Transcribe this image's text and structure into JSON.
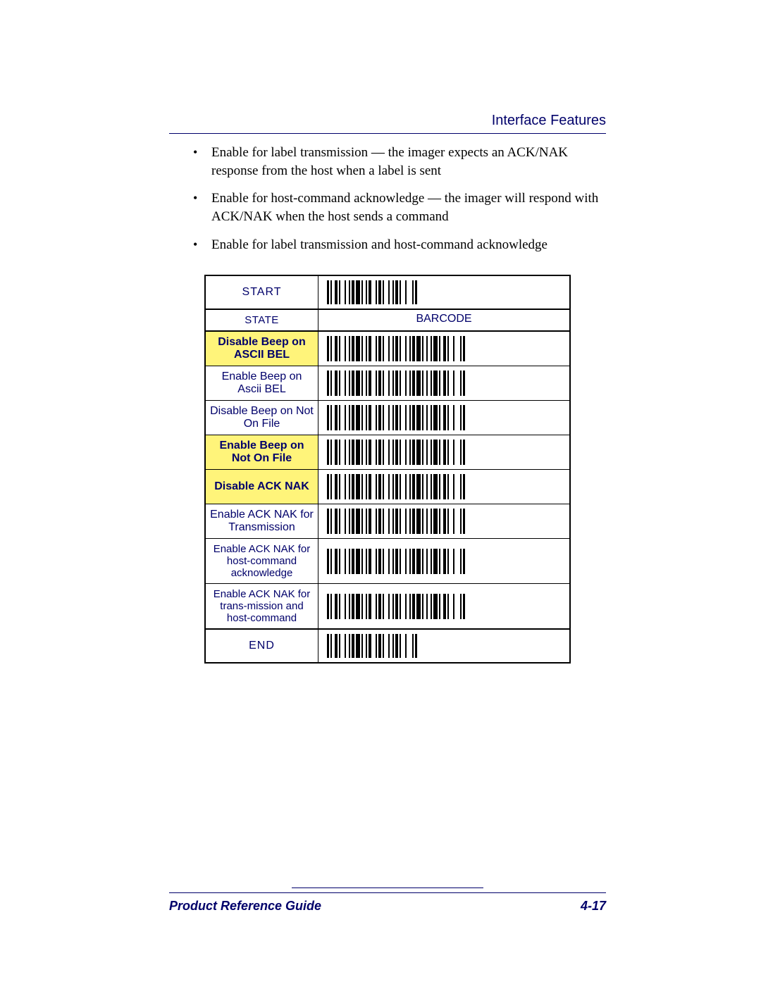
{
  "header": {
    "title": "Interface Features"
  },
  "bullets": [
    "Enable for label transmission — the imager expects an ACK/NAK response from the host when a label is sent",
    "Enable for host-command acknowledge — the imager will respond with ACK/NAK when the host sends a command",
    "Enable for label transmission and host-command acknowledge"
  ],
  "table": {
    "start_label": "START",
    "end_label": "END",
    "header_state": "STATE",
    "header_barcode": "BARCODE",
    "rows": [
      {
        "label": "Disable Beep on ASCII BEL",
        "highlight": true
      },
      {
        "label": "Enable Beep on Ascii BEL",
        "highlight": false
      },
      {
        "label": "Disable Beep on Not On File",
        "highlight": false
      },
      {
        "label": "Enable Beep on Not On File",
        "highlight": true
      },
      {
        "label": "Disable ACK NAK",
        "highlight": true
      },
      {
        "label": "Enable ACK NAK for Transmission",
        "highlight": false
      },
      {
        "label": "Enable ACK NAK for host-command acknowledge",
        "highlight": false
      },
      {
        "label": "Enable ACK NAK for trans-mission and host-command",
        "highlight": false
      }
    ]
  },
  "footer": {
    "left": "Product Reference Guide",
    "right": "4-17"
  }
}
